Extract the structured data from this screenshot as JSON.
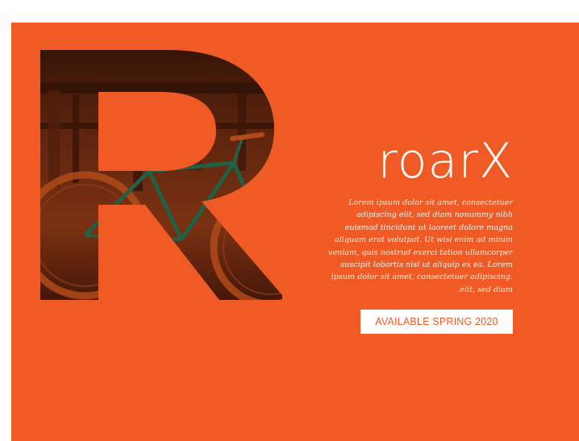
{
  "colors": {
    "accent": "#f05a24",
    "background": "#ffffff",
    "text": "#ffffff"
  },
  "hero": {
    "graphic": "letter-R-bicycle-photo-fill",
    "letter": "R"
  },
  "brand": {
    "name": "roarX"
  },
  "blurb": {
    "text": "Lorem ipsum dolor sit amet, consectetuer adipiscing elit, sed diam nonummy nibh euismod tincidunt ut laoreet dolore magna aliquam erat volutpat. Ut wisi enim ad minim veniam, quis nostrud exerci tation ullamcorper suscipit lobortis nisl ut aliquip ex ea. Lorem ipsum dolor sit amet, consectetuer adipiscing. .elit, sed diam"
  },
  "cta": {
    "label": "AVAILABLE SPRING 2020"
  }
}
